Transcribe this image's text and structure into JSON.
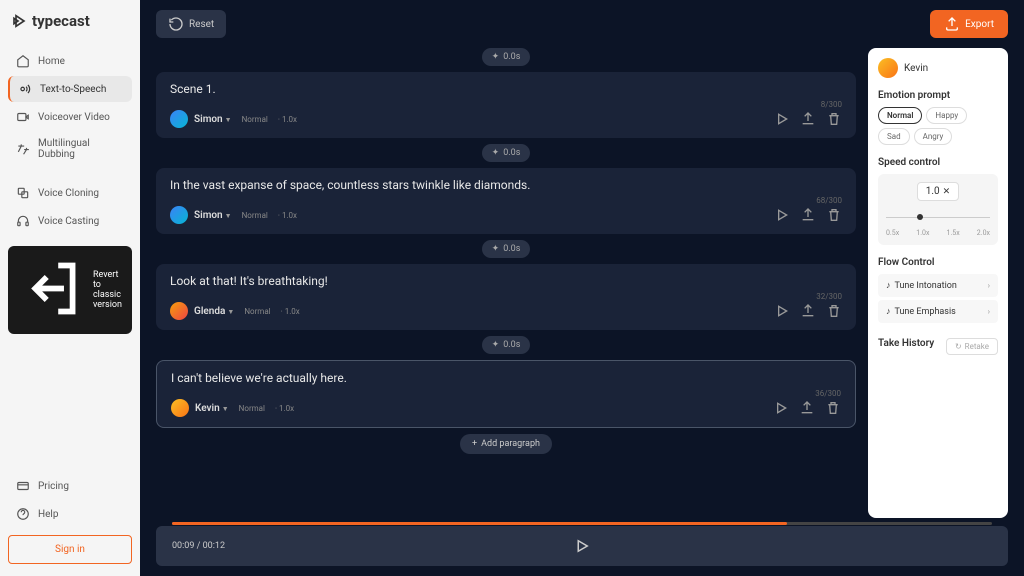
{
  "brand": "typecast",
  "sidebar": {
    "items": [
      {
        "label": "Home"
      },
      {
        "label": "Text-to-Speech"
      },
      {
        "label": "Voiceover Video"
      },
      {
        "label": "Multilingual Dubbing"
      },
      {
        "label": "Voice Cloning"
      },
      {
        "label": "Voice Casting"
      }
    ],
    "revert": "Revert to classic version",
    "pricing": "Pricing",
    "help": "Help",
    "signin": "Sign in"
  },
  "topbar": {
    "reset": "Reset",
    "export": "Export"
  },
  "timing_chip": "0.0s",
  "paragraphs": [
    {
      "text": "Scene 1.",
      "count": "8/300",
      "voice": "Simon",
      "emotion": "Normal",
      "speed": "1.0x"
    },
    {
      "text": "In the vast expanse of space, countless stars twinkle like diamonds.",
      "count": "68/300",
      "voice": "Simon",
      "emotion": "Normal",
      "speed": "1.0x"
    },
    {
      "text": "Look at that! It's breathtaking!",
      "count": "32/300",
      "voice": "Glenda",
      "emotion": "Normal",
      "speed": "1.0x"
    },
    {
      "text": "I can't believe we're actually here.",
      "count": "36/300",
      "voice": "Kevin",
      "emotion": "Normal",
      "speed": "1.0x"
    }
  ],
  "add_paragraph": "Add paragraph",
  "rightpanel": {
    "voice": "Kevin",
    "emotion_title": "Emotion prompt",
    "emotions": [
      "Normal",
      "Happy",
      "Sad",
      "Angry"
    ],
    "speed_title": "Speed control",
    "speed_value": "1.0",
    "speed_ticks": [
      "0.5x",
      "1.0x",
      "1.5x",
      "2.0x"
    ],
    "flow_title": "Flow Control",
    "flow_items": [
      "Tune Intonation",
      "Tune Emphasis"
    ],
    "take_title": "Take History",
    "retake": "Retake"
  },
  "player": {
    "time": "00:09 / 00:12",
    "progress_pct": 75
  }
}
